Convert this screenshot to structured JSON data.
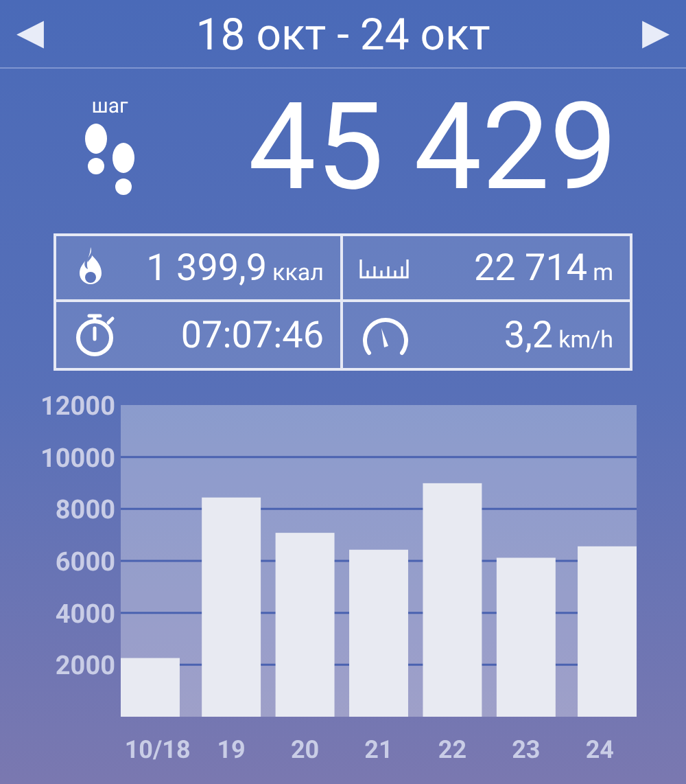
{
  "header": {
    "title": "18 окт - 24 окт",
    "prev": "◀",
    "next": "▶"
  },
  "steps": {
    "label": "шаг",
    "value": "45 429"
  },
  "stats": [
    {
      "kind": "calories",
      "value": "1 399,9",
      "unit": "ккал"
    },
    {
      "kind": "distance",
      "value": "22 714",
      "unit": "m"
    },
    {
      "kind": "time",
      "value": "07:07:46"
    },
    {
      "kind": "speed",
      "value": "3,2",
      "unit": "km/h"
    }
  ],
  "chart_data": {
    "type": "bar",
    "categories": [
      "10/18",
      "19",
      "20",
      "21",
      "22",
      "23",
      "24"
    ],
    "series": [
      {
        "color": "#e8eaf2",
        "values": [
          2260,
          8440,
          7080,
          6430,
          8990,
          6120,
          6560
        ]
      }
    ],
    "grid": true,
    "ylim": [
      0,
      12000
    ],
    "yticks": [
      2000,
      4000,
      6000,
      8000,
      10000,
      12000
    ]
  }
}
